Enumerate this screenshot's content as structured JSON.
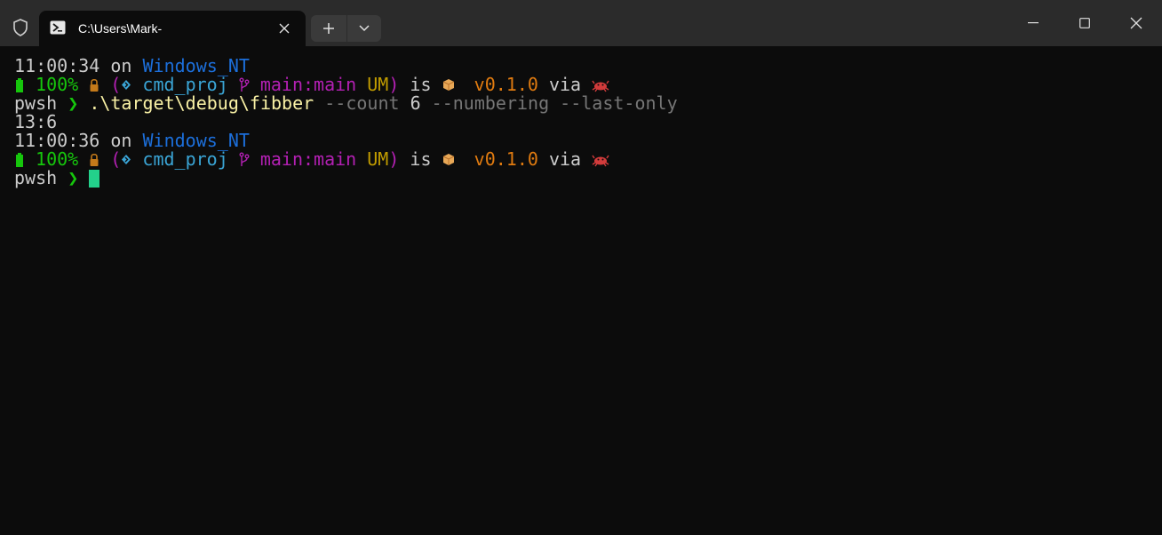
{
  "window": {
    "tab_title": "C:\\Users\\Mark-",
    "tab_icon": "powershell-icon",
    "shield_icon": "shield-icon"
  },
  "colors": {
    "background": "#0c0c0c",
    "titlebar": "#2b2b2b",
    "blue": "#1c6fdb",
    "green": "#16c60c",
    "cyan": "#3aa5d6",
    "magenta": "#b320b3",
    "yellow": "#c19c00",
    "orange": "#e07b10",
    "cursor": "#23d18b"
  },
  "terminal": {
    "prompt1": {
      "time": "11:00:34",
      "on": " on ",
      "os": "Windows_NT",
      "battery": "100%",
      "open_paren": " (",
      "project": "cmd_proj",
      "branch": "main:main",
      "status": "UM",
      "close_paren": ")",
      "is": " is ",
      "version": "v0.1.0",
      "via": " via "
    },
    "command1": {
      "shell": "pwsh",
      "chevron": "❯",
      "executable": ".\\target\\debug\\fibber",
      "arg1": "--count",
      "arg1_value": "6",
      "arg2": "--numbering",
      "arg3": "--last-only"
    },
    "output1": "13:6",
    "prompt2": {
      "time": "11:00:36",
      "on": " on ",
      "os": "Windows_NT",
      "battery": "100%",
      "open_paren": " (",
      "project": "cmd_proj",
      "branch": "main:main",
      "status": "UM",
      "close_paren": ")",
      "is": " is ",
      "version": "v0.1.0",
      "via": " via "
    },
    "command2": {
      "shell": "pwsh",
      "chevron": "❯"
    }
  }
}
